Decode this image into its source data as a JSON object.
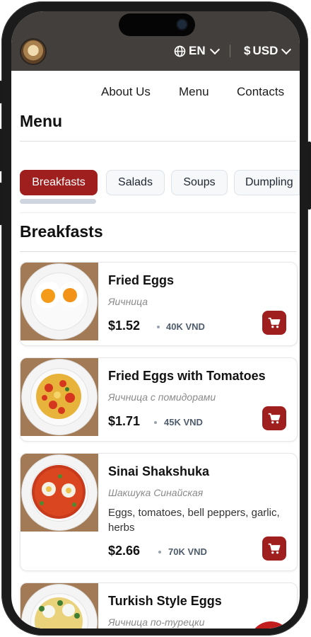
{
  "header": {
    "language": "EN",
    "currency": "USD",
    "currency_symbol": "$"
  },
  "nav": {
    "about": "About Us",
    "menu": "Menu",
    "contacts": "Contacts"
  },
  "page_title": "Menu",
  "categories": [
    {
      "label": "Breakfasts",
      "active": true
    },
    {
      "label": "Salads",
      "active": false
    },
    {
      "label": "Soups",
      "active": false
    },
    {
      "label": "Dumpling",
      "active": false
    }
  ],
  "section_title": "Breakfasts",
  "dishes": [
    {
      "name": "Fried Eggs",
      "subtitle": "Яичница",
      "price": "$1.52",
      "vnd": "40K VND"
    },
    {
      "name": "Fried Eggs with Tomatoes",
      "subtitle": "Яичница с помидорами",
      "price": "$1.71",
      "vnd": "45K VND"
    },
    {
      "name": "Sinai Shakshuka",
      "subtitle": "Шакшука Синайская",
      "description": "Eggs, tomatoes, bell peppers, garlic, herbs",
      "price": "$2.66",
      "vnd": "70K VND"
    },
    {
      "name": "Turkish Style Eggs",
      "subtitle": "Яичница по-турецки"
    }
  ],
  "colors": {
    "header_bg": "#433f3c",
    "accent": "#9f1f1f",
    "tab_bg": "#f6f8fa"
  },
  "icons": [
    "globe-icon",
    "chevron-down-icon",
    "cart-icon"
  ]
}
